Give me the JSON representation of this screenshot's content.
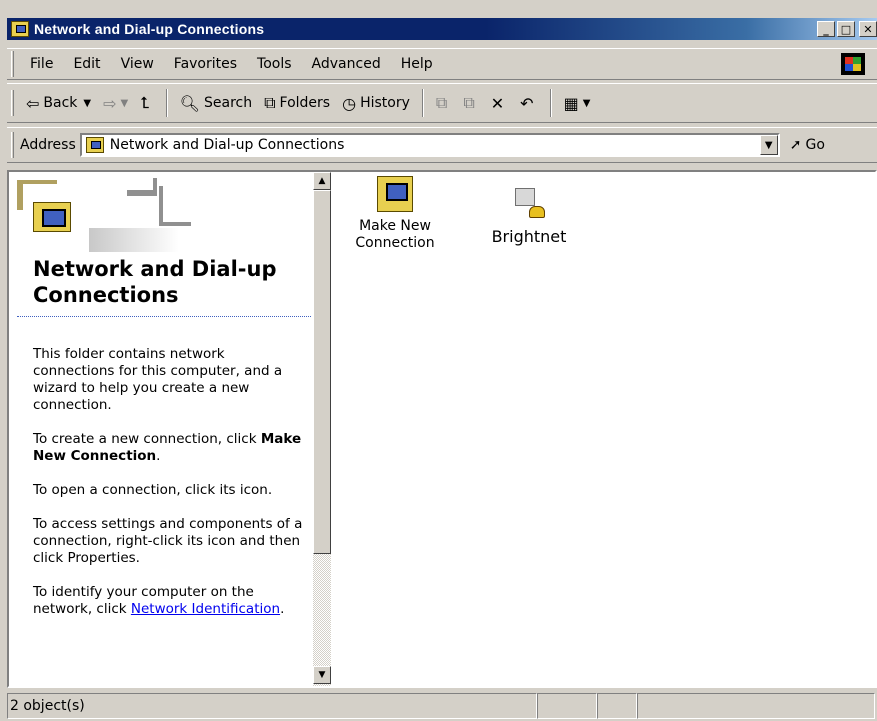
{
  "window": {
    "title": "Network and Dial-up Connections",
    "min": "_",
    "max": "□",
    "close": "✕"
  },
  "menu": {
    "items": [
      "File",
      "Edit",
      "View",
      "Favorites",
      "Tools",
      "Advanced",
      "Help"
    ]
  },
  "toolbar": {
    "back": "Back",
    "search": "Search",
    "folders": "Folders",
    "history": "History"
  },
  "address": {
    "label": "Address",
    "value": "Network and Dial-up Connections",
    "go": "Go"
  },
  "leftpane": {
    "title": "Network and Dial-up Connections",
    "para1": "This folder contains network connections for this computer, and a wizard to help you create a new connection.",
    "para2_prefix": "To create a new connection, click ",
    "para2_bold": "Make New Connection",
    "para2_suffix": ".",
    "para3": "To open a connection, click its icon.",
    "para4": "To access settings and components of a connection, right-click its icon and then click Properties.",
    "para5_prefix": "To identify your computer on the network, click ",
    "para5_link": "Network Identification",
    "para5_suffix": "."
  },
  "icons": [
    {
      "label": "Make New Connection"
    },
    {
      "label": "Brightnet"
    }
  ],
  "status": {
    "objects": "2 object(s)"
  }
}
